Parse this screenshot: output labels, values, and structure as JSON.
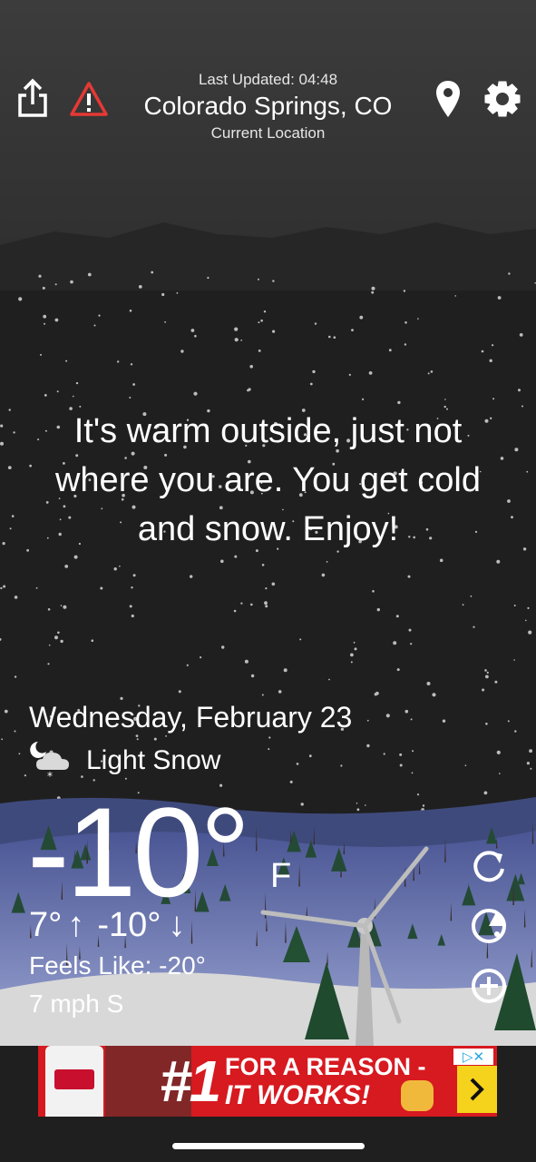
{
  "header": {
    "last_updated": "Last Updated: 04:48",
    "city": "Colorado Springs, CO",
    "location_type": "Current Location"
  },
  "icons": {
    "share": "share-icon",
    "alert": "warning-triangle-icon",
    "location": "map-pin-icon",
    "settings": "gear-icon",
    "condition": "night-snow-cloud-icon",
    "refresh": "refresh-icon",
    "radar": "radar-icon",
    "add": "add-circle-icon"
  },
  "message": "It's warm outside, just not where you are. You get cold and snow. Enjoy!",
  "weather": {
    "date": "Wednesday, February 23",
    "condition": "Light Snow",
    "temp": "-10°",
    "unit": "F",
    "high": "7°",
    "low": "-10°",
    "feels_like": "Feels Like: -20°",
    "wind": "7 mph S"
  },
  "ad": {
    "headline_number": "#1",
    "line1": "FOR A REASON -",
    "line2": "IT WORKS!",
    "accent": "#d71920",
    "cta_bg": "#f5d21c"
  },
  "colors": {
    "sky": "#3a3a3a",
    "night": "#1f1f1f",
    "ground": "#5c6aa6",
    "snow": "#dcdcdc"
  }
}
